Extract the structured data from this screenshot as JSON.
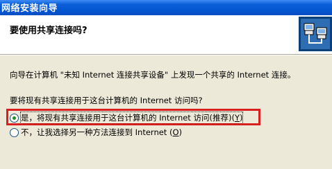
{
  "window": {
    "title": "网络安装向导"
  },
  "header": {
    "title": "要使用共享连接吗?",
    "icon": "network-computers-icon"
  },
  "body": {
    "description": "向导在计算机 \"未知 Internet 连接共享设备\" 上发现一个共享的 Internet 连接。",
    "question": "要将现有共享连接用于这台计算机的 Internet 访问吗?"
  },
  "options": [
    {
      "label": "是，将现有共享连接用于这台计算机的 Internet 访问(推荐)(",
      "accelerator": "Y",
      "label_suffix": ")",
      "selected": true
    },
    {
      "label": "不，让我选择另一种方法连接到 Internet (",
      "accelerator": "O",
      "label_suffix": ")",
      "selected": false
    }
  ],
  "colors": {
    "highlight_border": "#d81e1e",
    "title_bar": "#0454d0",
    "dialog_background": "#ece9d8"
  }
}
